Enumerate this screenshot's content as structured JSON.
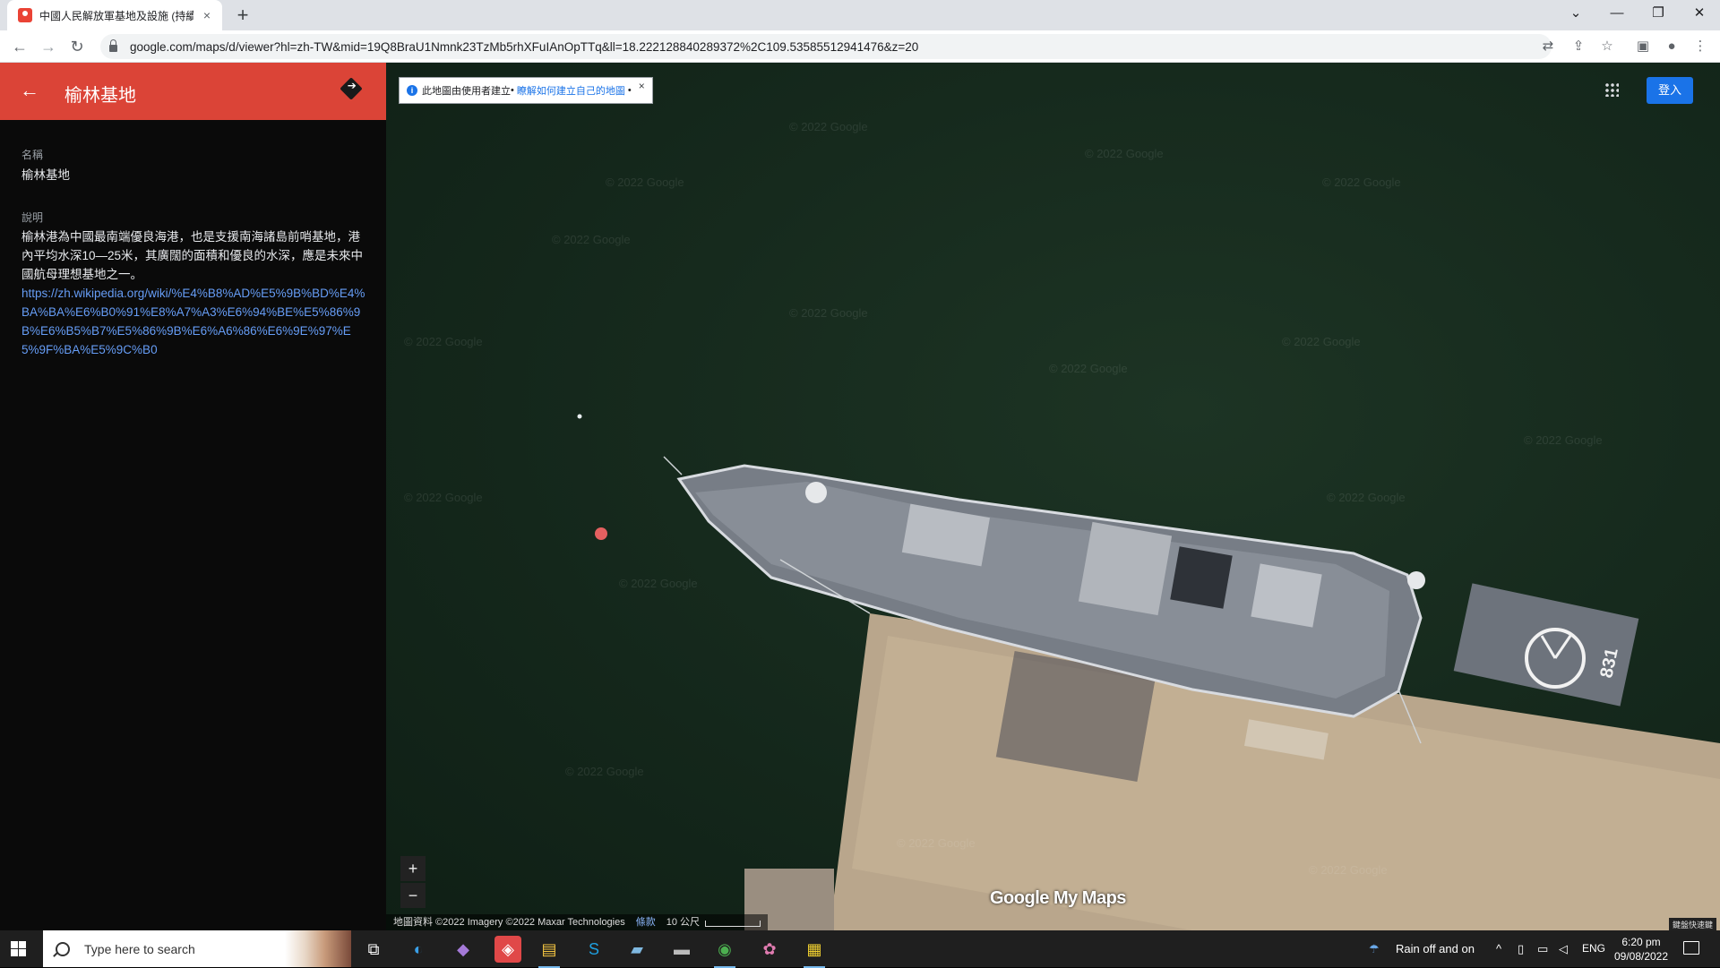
{
  "browser": {
    "tab_title": "中國人民解放軍基地及設施 (持續",
    "tab_close": "×",
    "new_tab": "+",
    "url": "google.com/maps/d/viewer?hl=zh-TW&mid=19Q8BraU1Nmnk23TzMb5rhXFuIAnOpTTq&ll=18.222128840289372%2C109.53585512941476&z=20",
    "window_controls": {
      "dropdown": "⌄",
      "minimize": "—",
      "restore": "❐",
      "close": "✕"
    },
    "nav": {
      "back": "←",
      "forward": "→",
      "reload": "↻"
    },
    "toolbar_icons": {
      "translate": "⇄",
      "share": "⇪",
      "bookmark": "☆",
      "extensions": "▣",
      "profile": "●",
      "menu": "⋮"
    }
  },
  "panel": {
    "title": "榆林基地",
    "back": "←",
    "name_label": "名稱",
    "name_value": "榆林基地",
    "desc_label": "說明",
    "desc_text": "榆林港為中國最南端優良海港，也是支援南海諸島前哨基地，港內平均水深10—25米，其廣闊的面積和優良的水深，應是未來中國航母理想基地之一。",
    "desc_link": "https://zh.wikipedia.org/wiki/%E4%B8%AD%E5%9B%BD%E4%BA%BA%E6%B0%91%E8%A7%A3%E6%94%BE%E5%86%9B%E6%B5%B7%E5%86%9B%E6%A6%86%E6%9E%97%E5%9F%BA%E5%9C%B0"
  },
  "map": {
    "info_text": "此地圖由使用者建立",
    "info_link": "瞭解如何建立自己的地圖",
    "info_close": "×",
    "signin": "登入",
    "zoom_in": "+",
    "zoom_out": "−",
    "brand": "Google My Maps",
    "attribution": "地圖資料 ©2022 Imagery ©2022 Maxar Technologies",
    "terms": "條款",
    "scale": "10 公尺",
    "hull_number": "831",
    "watermark": "© 2022 Google",
    "lang_badge": "鍵盤快速鍵"
  },
  "taskbar": {
    "search_placeholder": "Type here to search",
    "weather": "Rain off and on",
    "lang": "ENG",
    "time": "6:20 pm",
    "date": "09/08/2022"
  },
  "colors": {
    "header_red": "#db4437",
    "link_blue": "#669df6",
    "signin_blue": "#1a73e8"
  }
}
